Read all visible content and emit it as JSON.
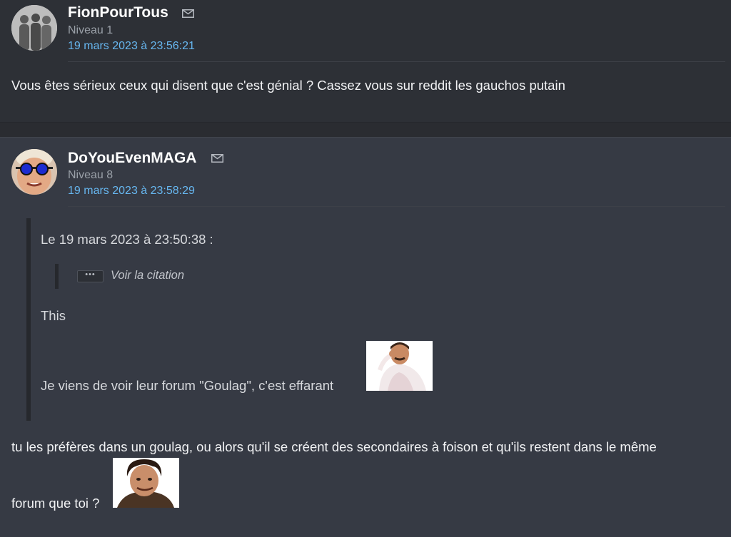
{
  "post1": {
    "username": "FionPourTous",
    "level": "Niveau 1",
    "date": "19 mars 2023 à 23:56:21",
    "message": "Vous êtes sérieux ceux qui disent que c'est génial ? Cassez vous sur reddit les gauchos putain",
    "avatar_icon": "silhouette-group-avatar",
    "mail_icon": "envelope-icon"
  },
  "post2": {
    "username": "DoYouEvenMAGA",
    "level": "Niveau 8",
    "date": "19 mars 2023 à 23:58:29",
    "avatar_icon": "face-with-blue-glasses-avatar",
    "mail_icon": "envelope-icon",
    "quote": {
      "header": "Le 19 mars 2023 à 23:50:38 :",
      "nested_toggle_dots": "•••",
      "nested_toggle_label": "Voir la citation",
      "line1": "This",
      "line2": "Je viens de voir leur forum \"Goulag\", c'est effarant"
    },
    "reply_line1": "tu les préfères dans un goulag, ou alors qu'il se créent des secondaires à foison et qu'ils restent dans le même",
    "reply_line2": "forum que toi ?"
  },
  "colors": {
    "background": "#2e3138",
    "post_bg": "#363a44",
    "date_link": "#67b7f0",
    "level_text": "#9aa0a8"
  }
}
